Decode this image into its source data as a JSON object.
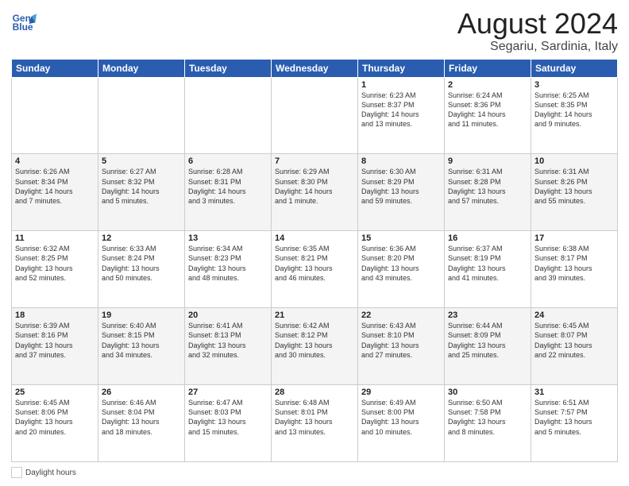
{
  "header": {
    "logo_line1": "General",
    "logo_line2": "Blue",
    "main_title": "August 2024",
    "subtitle": "Segariu, Sardinia, Italy"
  },
  "columns": [
    "Sunday",
    "Monday",
    "Tuesday",
    "Wednesday",
    "Thursday",
    "Friday",
    "Saturday"
  ],
  "weeks": [
    [
      {
        "day": "",
        "info": ""
      },
      {
        "day": "",
        "info": ""
      },
      {
        "day": "",
        "info": ""
      },
      {
        "day": "",
        "info": ""
      },
      {
        "day": "1",
        "info": "Sunrise: 6:23 AM\nSunset: 8:37 PM\nDaylight: 14 hours\nand 13 minutes."
      },
      {
        "day": "2",
        "info": "Sunrise: 6:24 AM\nSunset: 8:36 PM\nDaylight: 14 hours\nand 11 minutes."
      },
      {
        "day": "3",
        "info": "Sunrise: 6:25 AM\nSunset: 8:35 PM\nDaylight: 14 hours\nand 9 minutes."
      }
    ],
    [
      {
        "day": "4",
        "info": "Sunrise: 6:26 AM\nSunset: 8:34 PM\nDaylight: 14 hours\nand 7 minutes."
      },
      {
        "day": "5",
        "info": "Sunrise: 6:27 AM\nSunset: 8:32 PM\nDaylight: 14 hours\nand 5 minutes."
      },
      {
        "day": "6",
        "info": "Sunrise: 6:28 AM\nSunset: 8:31 PM\nDaylight: 14 hours\nand 3 minutes."
      },
      {
        "day": "7",
        "info": "Sunrise: 6:29 AM\nSunset: 8:30 PM\nDaylight: 14 hours\nand 1 minute."
      },
      {
        "day": "8",
        "info": "Sunrise: 6:30 AM\nSunset: 8:29 PM\nDaylight: 13 hours\nand 59 minutes."
      },
      {
        "day": "9",
        "info": "Sunrise: 6:31 AM\nSunset: 8:28 PM\nDaylight: 13 hours\nand 57 minutes."
      },
      {
        "day": "10",
        "info": "Sunrise: 6:31 AM\nSunset: 8:26 PM\nDaylight: 13 hours\nand 55 minutes."
      }
    ],
    [
      {
        "day": "11",
        "info": "Sunrise: 6:32 AM\nSunset: 8:25 PM\nDaylight: 13 hours\nand 52 minutes."
      },
      {
        "day": "12",
        "info": "Sunrise: 6:33 AM\nSunset: 8:24 PM\nDaylight: 13 hours\nand 50 minutes."
      },
      {
        "day": "13",
        "info": "Sunrise: 6:34 AM\nSunset: 8:23 PM\nDaylight: 13 hours\nand 48 minutes."
      },
      {
        "day": "14",
        "info": "Sunrise: 6:35 AM\nSunset: 8:21 PM\nDaylight: 13 hours\nand 46 minutes."
      },
      {
        "day": "15",
        "info": "Sunrise: 6:36 AM\nSunset: 8:20 PM\nDaylight: 13 hours\nand 43 minutes."
      },
      {
        "day": "16",
        "info": "Sunrise: 6:37 AM\nSunset: 8:19 PM\nDaylight: 13 hours\nand 41 minutes."
      },
      {
        "day": "17",
        "info": "Sunrise: 6:38 AM\nSunset: 8:17 PM\nDaylight: 13 hours\nand 39 minutes."
      }
    ],
    [
      {
        "day": "18",
        "info": "Sunrise: 6:39 AM\nSunset: 8:16 PM\nDaylight: 13 hours\nand 37 minutes."
      },
      {
        "day": "19",
        "info": "Sunrise: 6:40 AM\nSunset: 8:15 PM\nDaylight: 13 hours\nand 34 minutes."
      },
      {
        "day": "20",
        "info": "Sunrise: 6:41 AM\nSunset: 8:13 PM\nDaylight: 13 hours\nand 32 minutes."
      },
      {
        "day": "21",
        "info": "Sunrise: 6:42 AM\nSunset: 8:12 PM\nDaylight: 13 hours\nand 30 minutes."
      },
      {
        "day": "22",
        "info": "Sunrise: 6:43 AM\nSunset: 8:10 PM\nDaylight: 13 hours\nand 27 minutes."
      },
      {
        "day": "23",
        "info": "Sunrise: 6:44 AM\nSunset: 8:09 PM\nDaylight: 13 hours\nand 25 minutes."
      },
      {
        "day": "24",
        "info": "Sunrise: 6:45 AM\nSunset: 8:07 PM\nDaylight: 13 hours\nand 22 minutes."
      }
    ],
    [
      {
        "day": "25",
        "info": "Sunrise: 6:45 AM\nSunset: 8:06 PM\nDaylight: 13 hours\nand 20 minutes."
      },
      {
        "day": "26",
        "info": "Sunrise: 6:46 AM\nSunset: 8:04 PM\nDaylight: 13 hours\nand 18 minutes."
      },
      {
        "day": "27",
        "info": "Sunrise: 6:47 AM\nSunset: 8:03 PM\nDaylight: 13 hours\nand 15 minutes."
      },
      {
        "day": "28",
        "info": "Sunrise: 6:48 AM\nSunset: 8:01 PM\nDaylight: 13 hours\nand 13 minutes."
      },
      {
        "day": "29",
        "info": "Sunrise: 6:49 AM\nSunset: 8:00 PM\nDaylight: 13 hours\nand 10 minutes."
      },
      {
        "day": "30",
        "info": "Sunrise: 6:50 AM\nSunset: 7:58 PM\nDaylight: 13 hours\nand 8 minutes."
      },
      {
        "day": "31",
        "info": "Sunrise: 6:51 AM\nSunset: 7:57 PM\nDaylight: 13 hours\nand 5 minutes."
      }
    ]
  ],
  "legend": {
    "label": "Daylight hours"
  }
}
